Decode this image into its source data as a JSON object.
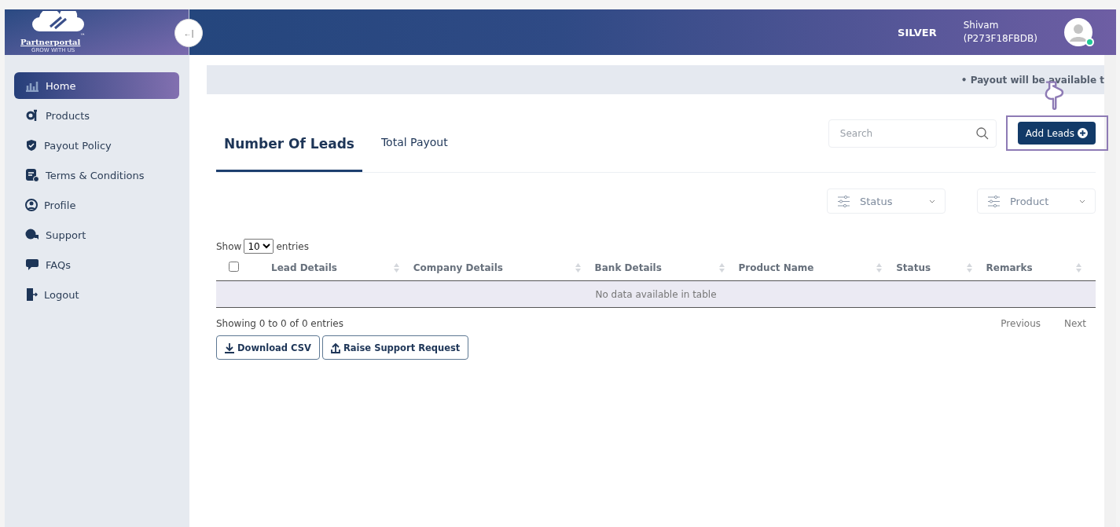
{
  "logo": {
    "name": "Partnerportal",
    "trademark": "™",
    "tagline": "GROW WITH US"
  },
  "collapse_button": {
    "label": "←|"
  },
  "header": {
    "tier": "SILVER",
    "user_name": "Shivam",
    "user_id": "(P273F18FBDB)",
    "online": true
  },
  "sidebar": {
    "items": [
      {
        "label": "Home",
        "selected": true
      },
      {
        "label": "Products",
        "selected": false
      },
      {
        "label": "Payout Policy",
        "selected": false
      },
      {
        "label": "Terms & Conditions",
        "selected": false
      },
      {
        "label": "Profile",
        "selected": false
      },
      {
        "label": "Support",
        "selected": false
      },
      {
        "label": "FAQs",
        "selected": false
      },
      {
        "label": "Logout",
        "selected": false
      }
    ]
  },
  "notice": "• Payout will be available t",
  "tabs": [
    {
      "label": "Number Of Leads",
      "selected": true
    },
    {
      "label": "Total Payout",
      "selected": false
    }
  ],
  "search": {
    "placeholder": "Search"
  },
  "add_button": {
    "label": "Add Leads",
    "highlighted": true
  },
  "filters": [
    {
      "label": "Status"
    },
    {
      "label": "Product"
    }
  ],
  "table": {
    "show_label": "Show",
    "page_size": "10",
    "entries_label": "entries",
    "select_all": false,
    "columns": [
      "Lead Details",
      "Company Details",
      "Bank Details",
      "Product Name",
      "Status",
      "Remarks"
    ],
    "empty": "No data available in table",
    "info": "Showing 0 to 0 of 0 entries",
    "previous": "Previous",
    "next": "Next"
  },
  "actions": [
    {
      "label": "Download CSV",
      "kind": "download"
    },
    {
      "label": "Raise Support Request",
      "kind": "upload"
    }
  ]
}
